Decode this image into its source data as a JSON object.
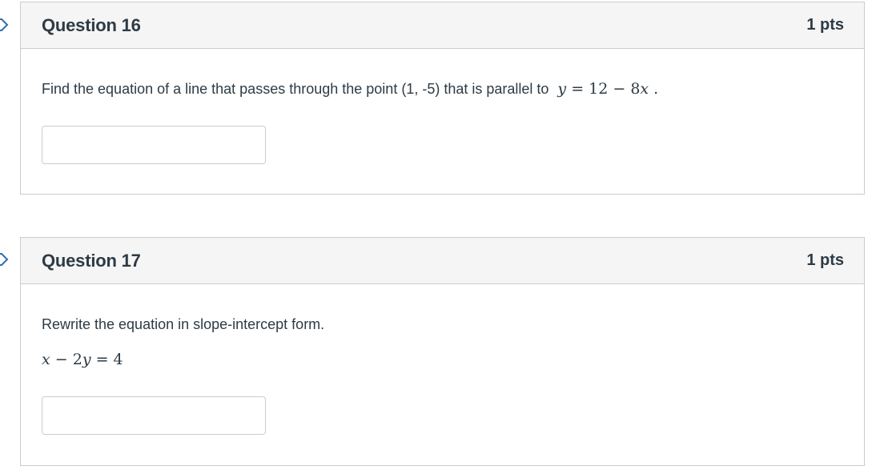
{
  "questions": [
    {
      "title": "Question 16",
      "points": "1 pts",
      "prompt": "Find the equation of a line that passes through the point (1, -5) that is parallel to",
      "math_y": "y",
      "math_eq": " = 12 − 8",
      "math_x": "x",
      "math_tail": " .",
      "answer_value": ""
    },
    {
      "title": "Question 17",
      "points": "1 pts",
      "prompt": "Rewrite the equation in slope-intercept form.",
      "math_x": "x",
      "math_mid": " − 2",
      "math_y": "y",
      "math_eq": " = 4",
      "answer_value": ""
    }
  ],
  "icons": {
    "flag": "bookmark-flag-icon"
  },
  "colors": {
    "border": "#c7cdd1",
    "header_bg": "#f5f5f5",
    "text": "#2d3b45"
  }
}
